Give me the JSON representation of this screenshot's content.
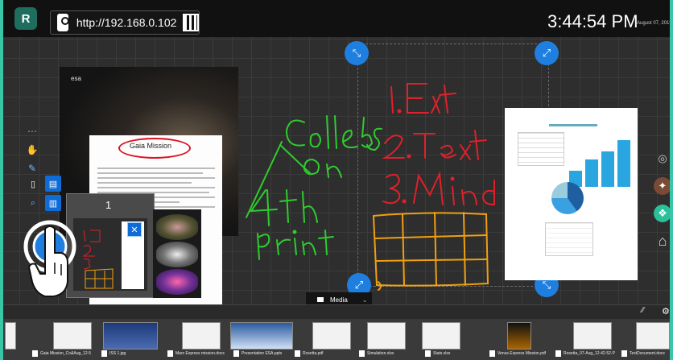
{
  "app": {
    "logo": "R",
    "url": "http://192.168.0.102",
    "time": "3:44:54 PM",
    "date": "August 07, 2019"
  },
  "documents": {
    "gaia_title": "Gaia Mission",
    "esa_mark": "esa",
    "popup_page_number": "1",
    "popup_close": "✕"
  },
  "media_tab": {
    "label": "Media"
  },
  "toolbar_right": {
    "icons": [
      "globe-icon",
      "tools-icon",
      "logo-icon",
      "home-icon"
    ]
  },
  "tray": {
    "items": [
      {
        "label": "Gaia Mission_Co&Aug_12-5",
        "type": "doc"
      },
      {
        "label": "ISS 1.jpg",
        "type": "photo"
      },
      {
        "label": "Mars Express mission.docx",
        "type": "doc"
      },
      {
        "label": "Presentation ESA.pptx",
        "type": "photo"
      },
      {
        "label": "Rosetta.pdf",
        "type": "doc"
      },
      {
        "label": "Simulation.xlsx",
        "type": "doc"
      },
      {
        "label": "Stats.xlsx",
        "type": "doc"
      },
      {
        "label": "Venus Express Mission.pdf",
        "type": "doc"
      },
      {
        "label": "Rosetta_07-Aug_12-42-52-P",
        "type": "doc"
      },
      {
        "label": "TextDocument.docx",
        "type": "doc"
      }
    ]
  },
  "colors": {
    "teal_frame": "#39c6a6",
    "handle_blue": "#1e7fe0",
    "ink_red": "#e0202a",
    "ink_green": "#2ecc2e",
    "ink_orange": "#f0a010"
  },
  "handwriting": {
    "red_list": [
      "1. Ent",
      "2. Text",
      "3. Mind"
    ],
    "green_note": [
      "Colleb on",
      "4th print"
    ]
  }
}
